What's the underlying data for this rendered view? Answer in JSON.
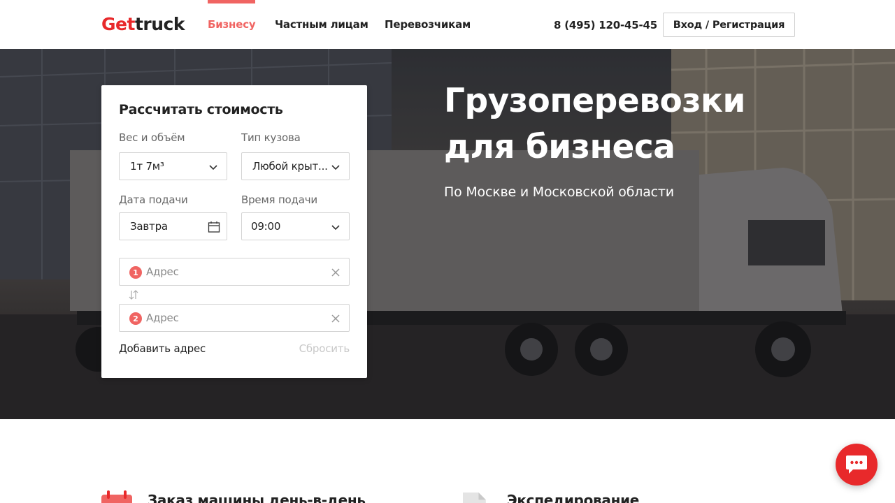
{
  "header": {
    "logo": {
      "part1": "Get",
      "part2": "truck"
    },
    "nav": [
      {
        "label": "Бизнесу",
        "active": true
      },
      {
        "label": "Частным лицам",
        "active": false
      },
      {
        "label": "Перевозчикам",
        "active": false
      }
    ],
    "phone": "8 (495) 120-45-45",
    "login_label": "Вход / Регистрация"
  },
  "hero": {
    "title_line1": "Грузоперевозки",
    "title_line2": "для бизнеса",
    "subtitle": "По Москве и Московской области"
  },
  "calculator": {
    "title": "Рассчитать стоимость",
    "weight": {
      "label": "Вес и объём",
      "value": "1т 7м³"
    },
    "body_type": {
      "label": "Тип кузова",
      "value": "Любой крыт..."
    },
    "date": {
      "label": "Дата подачи",
      "value": "Завтра"
    },
    "time": {
      "label": "Время подачи",
      "value": "09:00"
    },
    "addresses": [
      {
        "number": "1",
        "placeholder": "Адрес"
      },
      {
        "number": "2",
        "placeholder": "Адрес"
      }
    ],
    "add_address_label": "Добавить адрес",
    "reset_label": "Сбросить"
  },
  "features": [
    {
      "title": "Заказ машины день-в-день",
      "icon": "calendar-icon"
    },
    {
      "title": "Экспедирование",
      "icon": "document-icon"
    }
  ],
  "colors": {
    "accent": "#e8292b",
    "nav_active": "#f06462"
  },
  "chat": {
    "icon": "chat-icon"
  }
}
